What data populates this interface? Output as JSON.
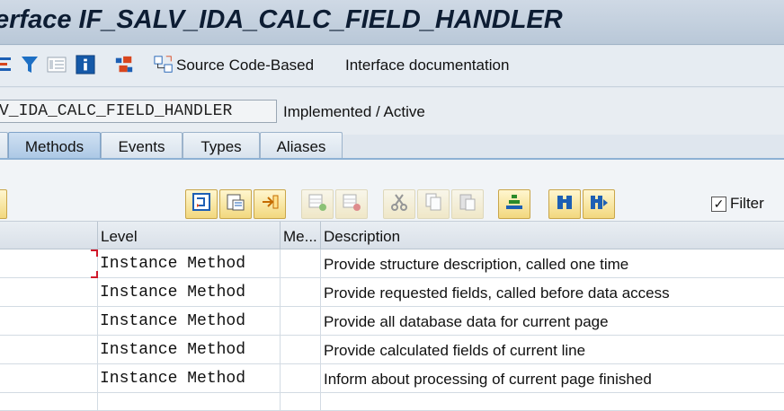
{
  "window": {
    "title": "erface IF_SALV_IDA_CALC_FIELD_HANDLER"
  },
  "toolbar": {
    "icons": [
      "where-used-list-icon",
      "filter-icon",
      "display-object-list-icon",
      "information-icon",
      "hierarchy-icon",
      "source-code-based-icon"
    ],
    "source_code_based_label": "Source Code-Based",
    "interface_documentation_label": "Interface documentation"
  },
  "header": {
    "interface_name_value": "V_IDA_CALC_FIELD_HANDLER",
    "status": "Implemented / Active"
  },
  "tabs": [
    {
      "label": "Methods",
      "active": true
    },
    {
      "label": "Events",
      "active": false
    },
    {
      "label": "Types",
      "active": false
    },
    {
      "label": "Aliases",
      "active": false
    }
  ],
  "app_toolbar": {
    "buttons": [
      "navigate-icon",
      "display-change-icon",
      "detail-icon",
      "insert-row-icon",
      "delete-row-icon",
      "cut-icon",
      "copy-icon",
      "paste-icon",
      "sort-icon",
      "binoculars-icon",
      "find-next-icon"
    ],
    "filter_label": "Filter",
    "filter_checked": true
  },
  "grid": {
    "columns": [
      "Level",
      "Me...",
      "Description"
    ],
    "rows": [
      {
        "level": "Instance Method",
        "me": "",
        "description": "Provide structure description, called one time"
      },
      {
        "level": "Instance Method",
        "me": "",
        "description": "Provide requested fields, called before data access"
      },
      {
        "level": "Instance Method",
        "me": "",
        "description": "Provide all database data for current page"
      },
      {
        "level": "Instance Method",
        "me": "",
        "description": "Provide calculated fields of current line"
      },
      {
        "level": "Instance Method",
        "me": "",
        "description": "Inform about processing of current page finished"
      }
    ]
  },
  "colors": {
    "accent": "#0a5fb0",
    "button_yellow": "#f2d87e",
    "tab_active": "#a9c6e4"
  }
}
